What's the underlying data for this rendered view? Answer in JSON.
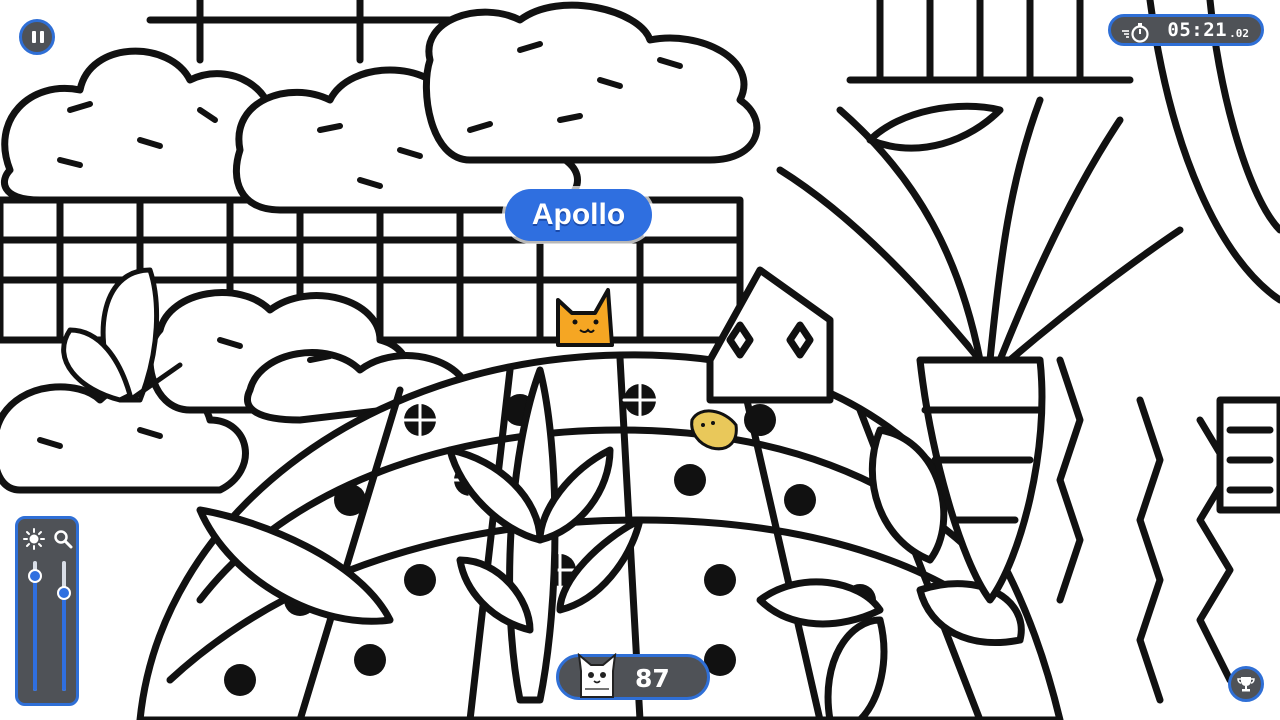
{
  "game": {
    "found_cat_name": "Apollo",
    "cats_remaining": "87"
  },
  "timer": {
    "main": "05:21",
    "centiseconds": ".02"
  },
  "icons": {
    "pause": "pause-icon",
    "timer": "stopwatch-icon",
    "brightness": "sun-icon",
    "zoom": "magnifier-icon",
    "cat": "cat-face-icon",
    "trophy": "trophy-icon"
  },
  "sliders": {
    "brightness_level": 0.85,
    "zoom_level": 0.75
  },
  "colors": {
    "accent": "#2f6fe0",
    "hud_background": "#4f5257",
    "cat_orange": "#f5a623",
    "line_art": "#111111",
    "background": "#ffffff"
  }
}
